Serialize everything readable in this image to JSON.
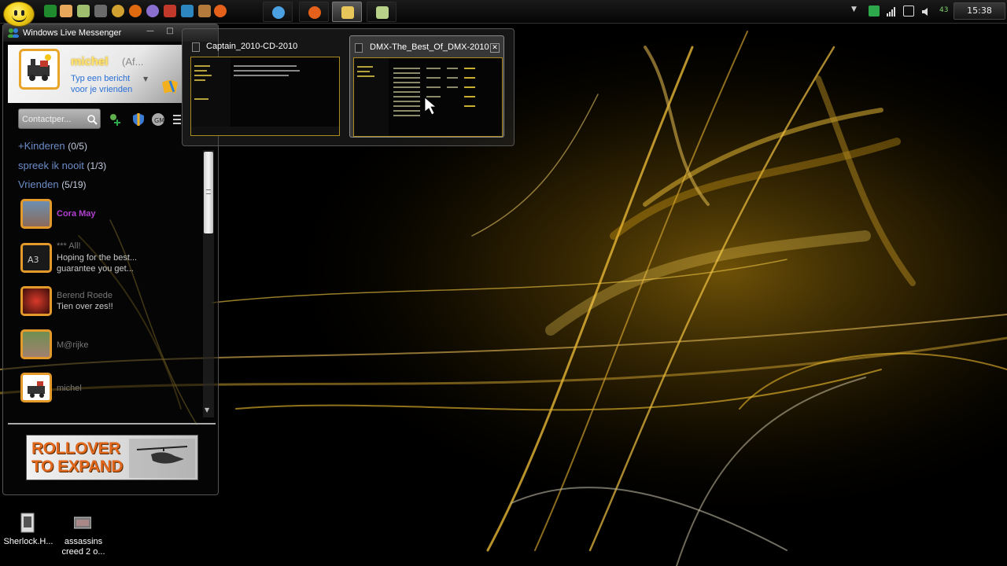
{
  "taskbar": {
    "tray": {
      "temperature": "43",
      "clock": "15:38"
    },
    "colors": {
      "accent": "#f5d31a"
    }
  },
  "messenger": {
    "title": "Windows Live Messenger",
    "profile": {
      "name": "michel",
      "status": "(Af...",
      "personal_message_line1": "Typ een bericht",
      "personal_message_line2": "voor je vrienden"
    },
    "search": {
      "placeholder": "Contactper..."
    },
    "groups": [
      {
        "name": "+Kinderen",
        "count": "(0/5)"
      },
      {
        "name": "spreek ik nooit",
        "count": "(1/3)"
      },
      {
        "name": "Vrienden",
        "count": "(5/19)"
      }
    ],
    "contacts": [
      {
        "name": "Cora May",
        "message": ""
      },
      {
        "name": "*** All!",
        "message_line1": "Hoping for the best...",
        "message_line2": "guarantee you get..."
      },
      {
        "name": "Berend Roede",
        "message": "Tien over zes!!"
      },
      {
        "name": "M@rijke",
        "message": ""
      },
      {
        "name": "michel",
        "message": ""
      }
    ],
    "ad": {
      "line1": "ROLLOVER",
      "line2": "TO EXPAND"
    }
  },
  "peek": {
    "windows": [
      {
        "title": "Captain_2010-CD-2010"
      },
      {
        "title": "DMX-The_Best_Of_DMX-2010",
        "close": "✕"
      }
    ]
  },
  "desktop": {
    "icons": [
      {
        "label": "Sherlock.H..."
      },
      {
        "label_line1": "assassins",
        "label_line2": "creed 2 o..."
      }
    ]
  }
}
